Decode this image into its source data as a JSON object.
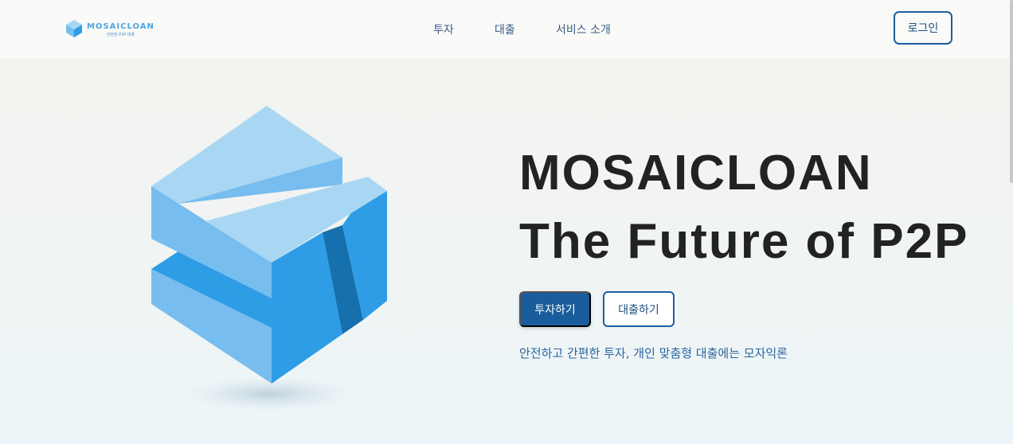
{
  "header": {
    "logo": {
      "brand": "MOSAICLOAN",
      "tagline": "안전한 P2P 대출",
      "icon": "cube-logo-icon"
    },
    "nav": [
      {
        "label": "투자"
      },
      {
        "label": "대출"
      },
      {
        "label": "서비스 소개"
      }
    ],
    "login_label": "로그인"
  },
  "hero": {
    "title_line1": "MOSAICLOAN",
    "title_line2": "The Future of P2P",
    "invest_label": "투자하기",
    "loan_label": "대출하기",
    "subtitle": "안전하고 간편한 투자, 개인 맞춤형 대출에는 모자익론",
    "art_icon": "3d-s-block-icon"
  },
  "colors": {
    "primary": "#1a5d9c",
    "accent_light": "#a9d7f3",
    "accent_mid": "#77bdef",
    "accent_bright": "#2e9de6",
    "title": "#222222"
  }
}
